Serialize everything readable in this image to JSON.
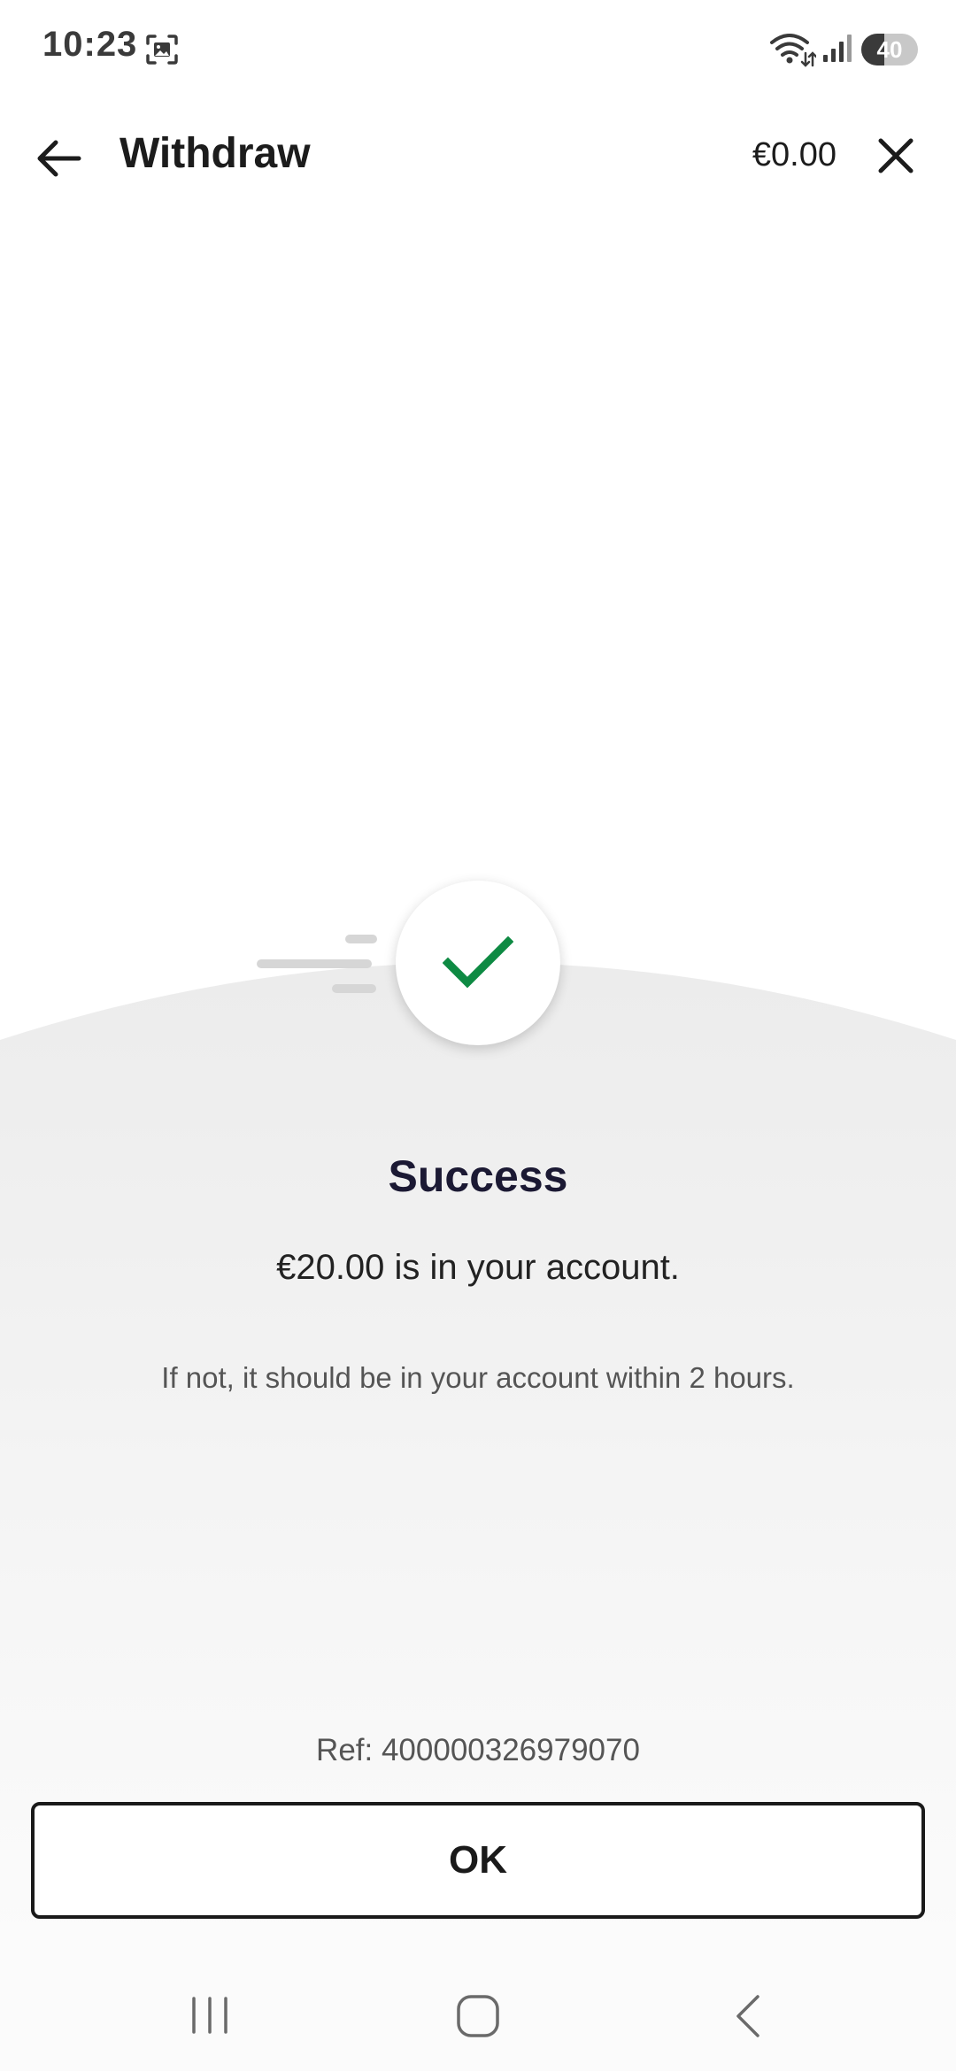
{
  "status_bar": {
    "time": "10:23",
    "battery_level": "40",
    "battery_fraction": 0.4,
    "icons": [
      "screenshot-icon",
      "wifi-icon",
      "signal-icon",
      "battery-icon"
    ]
  },
  "app_bar": {
    "title": "Withdraw",
    "balance": "€0.00",
    "back_icon": "arrow-left-icon",
    "close_icon": "close-icon"
  },
  "result": {
    "status_icon": "check-icon",
    "title": "Success",
    "amount_message": "€20.00 is in your account.",
    "info_message": "If not, it should be in your account within 2 hours.",
    "reference": "Ref: 400000326979070"
  },
  "actions": {
    "ok_label": "OK"
  },
  "navigation": {
    "items": [
      "recents-icon",
      "home-icon",
      "back-icon"
    ]
  },
  "colors": {
    "success_green": "#0e8a43",
    "title_navy": "#1b1933",
    "background_curve": "#efefef"
  }
}
